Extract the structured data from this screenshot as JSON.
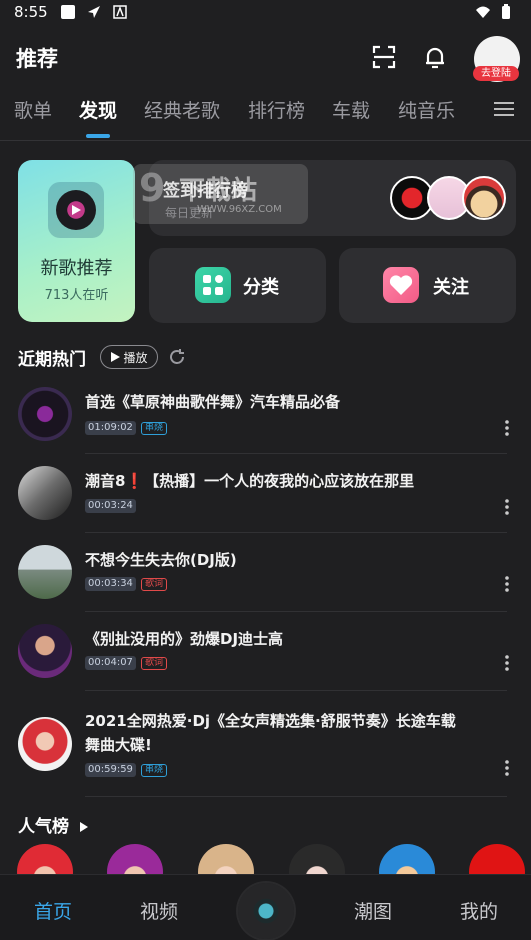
{
  "status_bar": {
    "time": "8:55"
  },
  "header": {
    "title": "推荐",
    "login_badge": "去登陆"
  },
  "tabs": [
    {
      "label": "歌单"
    },
    {
      "label": "发现"
    },
    {
      "label": "经典老歌"
    },
    {
      "label": "排行榜"
    },
    {
      "label": "车载"
    },
    {
      "label": "纯音乐"
    }
  ],
  "cards": {
    "new_songs": {
      "title": "新歌推荐",
      "listeners": "713人在听"
    },
    "ranking": {
      "title": "签到排行榜",
      "subtitle": "每日更新"
    },
    "category": {
      "label": "分类"
    },
    "follow": {
      "label": "关注"
    }
  },
  "watermark": {
    "brand": "下载站",
    "number": "9",
    "url": "WWW.96XZ.COM"
  },
  "hot": {
    "title": "近期热门",
    "play_label": "播放"
  },
  "songs": [
    {
      "name": "首选《草原神曲歌伴舞》汽车精品必备",
      "duration": "01:09:02",
      "tag": "串烧",
      "tag_color": "blue"
    },
    {
      "name": "潮音8❗【热播】一个人的夜我的心应该放在那里",
      "duration": "00:03:24",
      "tag": "",
      "tag_color": ""
    },
    {
      "name": "不想今生失去你(DJ版)",
      "duration": "00:03:34",
      "tag": "歌词",
      "tag_color": "red"
    },
    {
      "name": "《别扯没用的》劲爆DJ迪士高",
      "duration": "00:04:07",
      "tag": "歌词",
      "tag_color": "red"
    },
    {
      "name": "2021全网热爱·Dj《全女声精选集·舒服节奏》长途车载舞曲大碟!",
      "duration": "00:59:59",
      "tag": "串烧",
      "tag_color": "blue"
    }
  ],
  "popular": {
    "title": "人气榜"
  },
  "bottom_nav": [
    {
      "label": "首页"
    },
    {
      "label": "视频"
    },
    {
      "label": "潮图"
    },
    {
      "label": "我的"
    }
  ],
  "colors": {
    "accent": "#3aa6e8",
    "background": "#1f1f21",
    "card": "#2e2e31",
    "badge_red": "#e8353f"
  }
}
